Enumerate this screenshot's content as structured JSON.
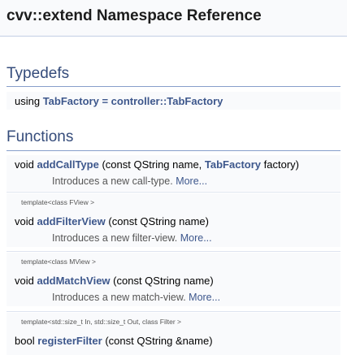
{
  "page": {
    "title": "cvv::extend Namespace Reference"
  },
  "sections": {
    "typedefs": {
      "heading": "Typedefs",
      "items": [
        {
          "keyword": "using",
          "name": "TabFactory",
          "equals": "=",
          "target": "controller::TabFactory"
        }
      ]
    },
    "functions": {
      "heading": "Functions",
      "items": [
        {
          "return_type": "void",
          "name": "addCallType",
          "params_pre": "(const QString name,",
          "param_link": "TabFactory",
          "params_post": "factory)",
          "description": "Introduces a new call-type.",
          "more": "More..."
        },
        {
          "template": "template<class FView >",
          "return_type": "void",
          "name": "addFilterView",
          "params": "(const QString name)",
          "description": "Introduces a new filter-view.",
          "more": "More..."
        },
        {
          "template": "template<class MView >",
          "return_type": "void",
          "name": "addMatchView",
          "params": "(const QString name)",
          "description": "Introduces a new match-view.",
          "more": "More..."
        },
        {
          "template": "template<std::size_t In, std::size_t Out, class Filter >",
          "return_type": "bool",
          "name": "registerFilter",
          "params": "(const QString &name)"
        }
      ]
    }
  }
}
